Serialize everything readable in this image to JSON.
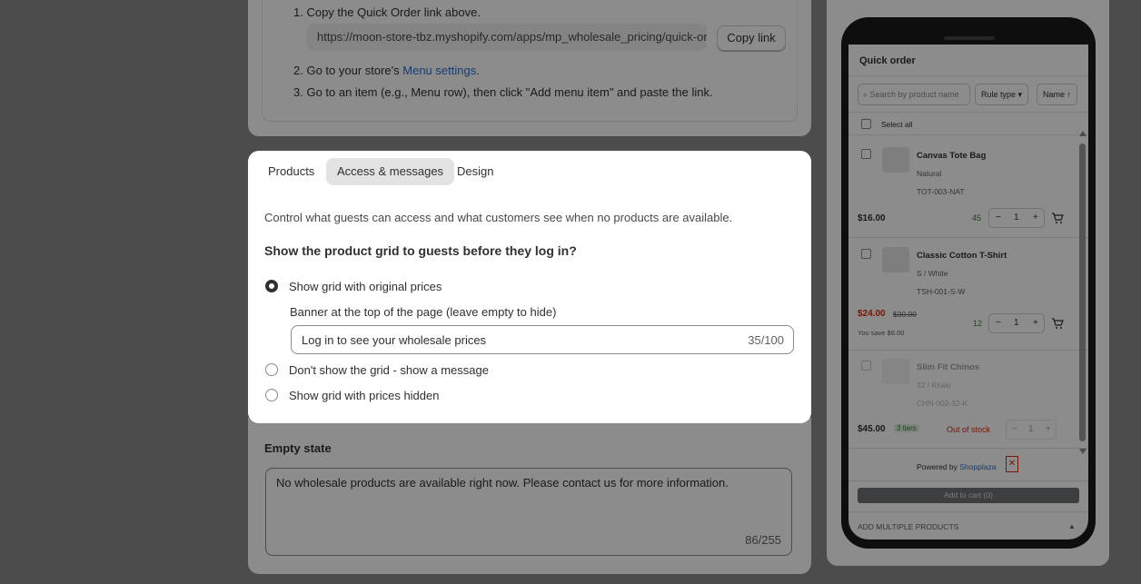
{
  "install": {
    "step1": "1. Copy the Quick Order link above.",
    "url": "https://moon-store-tbz.myshopify.com/apps/mp_wholesale_pricing/quick-order",
    "copy_label": "Copy link",
    "step2_prefix": "2. Go to your store's ",
    "step2_link": "Menu settings",
    "step2_suffix": ".",
    "step3": "3. Go to an item (e.g., Menu row), then click \"Add menu item\" and paste the link."
  },
  "tabs": [
    {
      "label": "Products"
    },
    {
      "label": "Access & messages",
      "active": true
    },
    {
      "label": "Design"
    }
  ],
  "access": {
    "intro": "Control what guests can access and what customers see when no products are available.",
    "question": "Show the product grid to guests before they log in?",
    "options": [
      {
        "label": "Show grid with original prices",
        "selected": true
      },
      {
        "label": "Don't show the grid - show a message",
        "selected": false
      },
      {
        "label": "Show grid with prices hidden",
        "selected": false
      }
    ],
    "banner_label": "Banner at the top of the page (leave empty to hide)",
    "banner_value": "Log in to see your wholesale prices",
    "banner_count": "35/100"
  },
  "empty_state": {
    "title": "Empty state",
    "text": "No wholesale products are available right now. Please contact us for more information.",
    "count": "86/255"
  },
  "preview": {
    "title": "Quick order",
    "search_placeholder": "⌕ Search by product name",
    "rule_type": "Rule type ▾",
    "sort": "Name ↑",
    "select_all": "Select all",
    "products": [
      {
        "name": "Canvas Tote Bag",
        "variant": "Natural",
        "sku": "TOT-003-NAT",
        "price": "$16.00",
        "compare": "",
        "save": "",
        "stock": "45",
        "qty": "1"
      },
      {
        "name": "Classic Cotton T-Shirt",
        "variant": "S / White",
        "sku": "TSH-001-S-W",
        "price": "$24.00",
        "compare": "$30.00",
        "save": "You save $6.00",
        "stock": "12",
        "qty": "1"
      },
      {
        "name": "Slim Fit Chinos",
        "variant": "32 / Khaki",
        "sku": "CHN-002-32-K",
        "price": "$45.00",
        "tiers": "3 tiers",
        "stock": "Out of stock",
        "qty": "1"
      }
    ],
    "powered_prefix": "Powered by",
    "powered_link": "Shopplaza",
    "close": "✕",
    "add_to_cart": "Add to cart (0)",
    "add_multiple": "ADD MULTIPLE PRODUCTS",
    "add_multiple_caret": "▲",
    "colors": {
      "sale": "#d72c0d",
      "stock": "#2a7d2e",
      "out": "#d72c0d",
      "link": "#2c6ecb"
    }
  }
}
